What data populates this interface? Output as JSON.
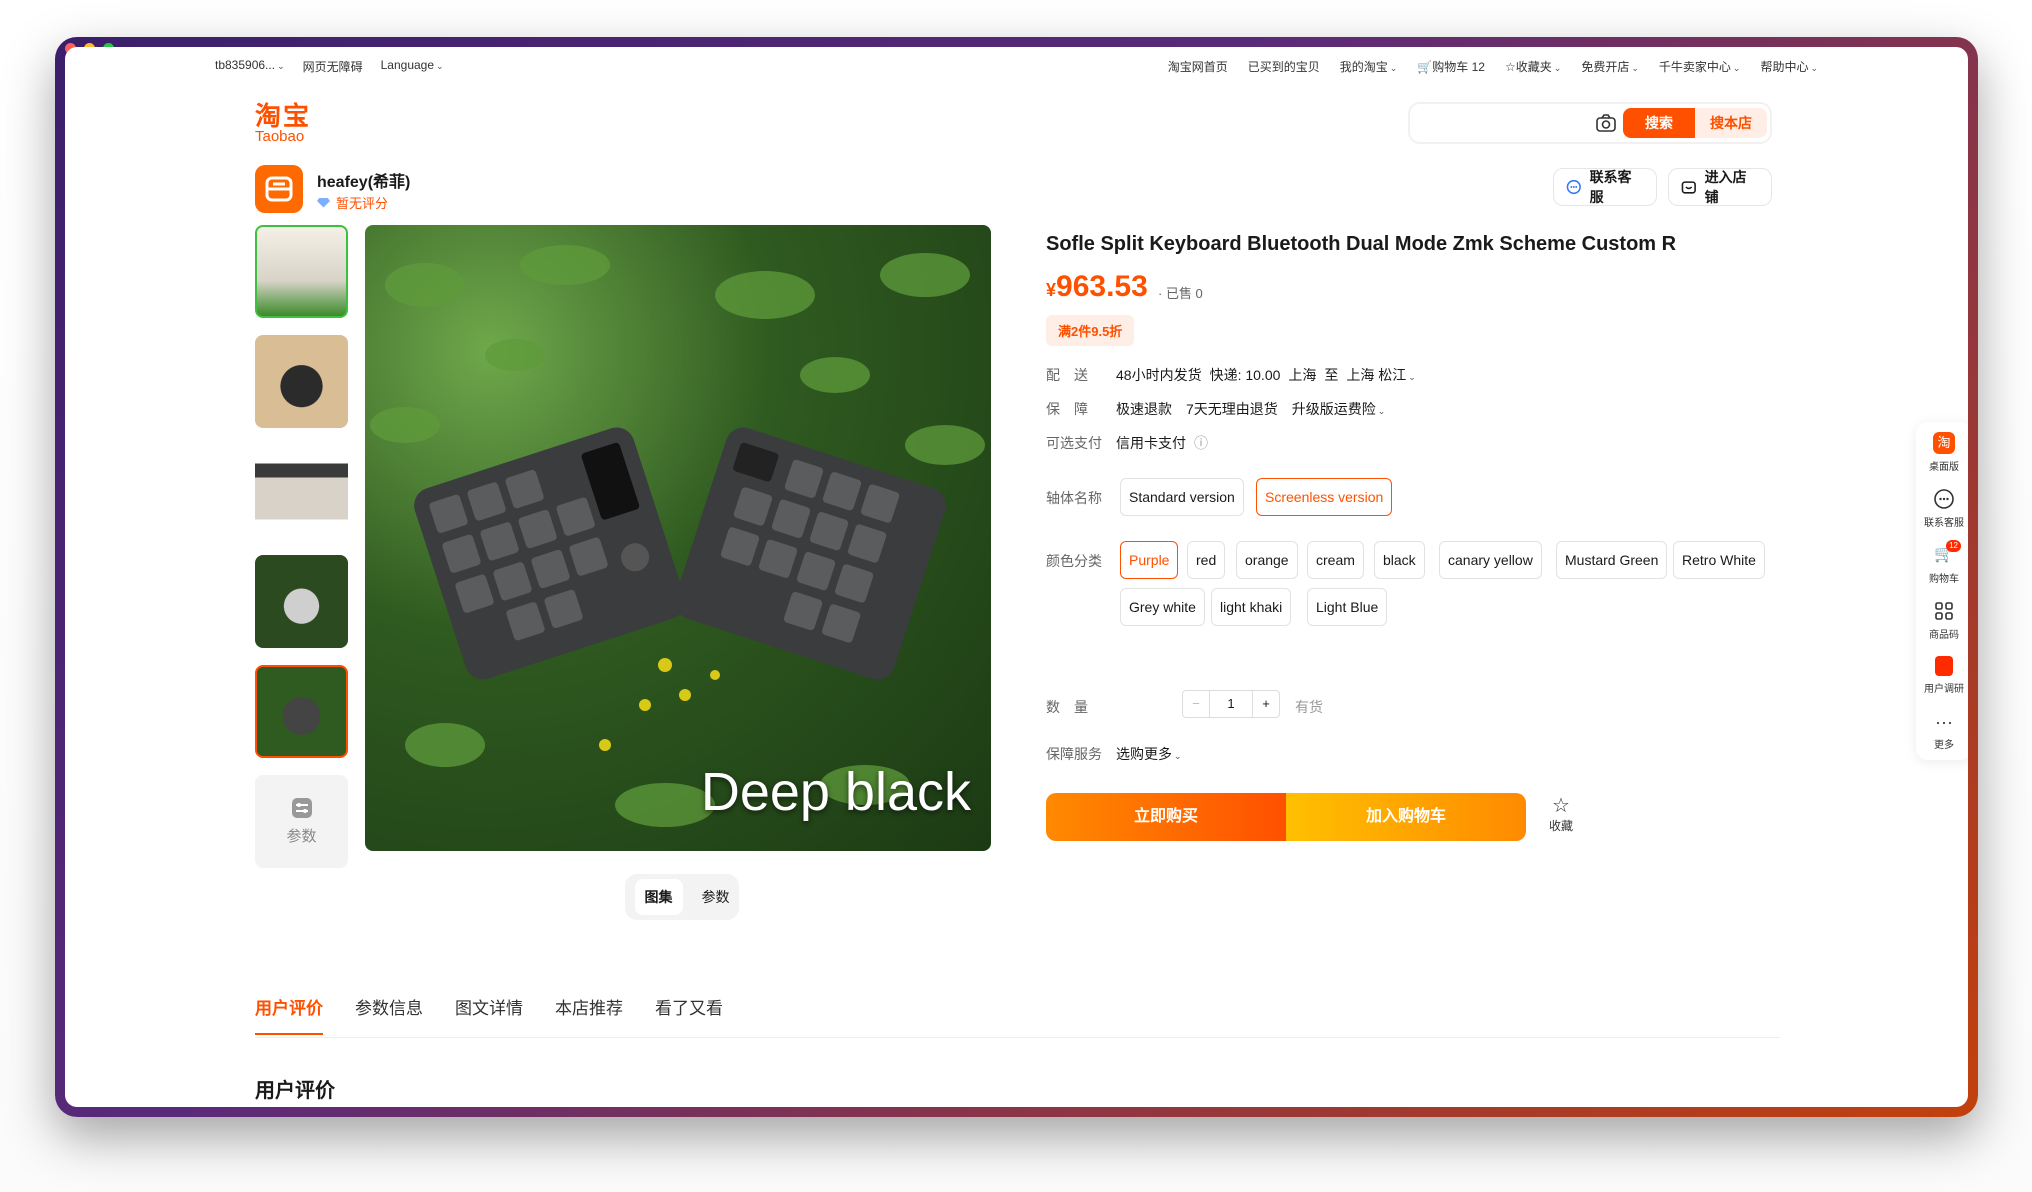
{
  "topbar": {
    "left": [
      "tb835906...",
      "网页无障碍",
      "Language"
    ],
    "right": [
      "淘宝网首页",
      "已买到的宝贝",
      "我的淘宝",
      "购物车 12",
      "收藏夹",
      "免费开店",
      "千牛卖家中心",
      "帮助中心"
    ]
  },
  "logo": {
    "cn": "淘宝",
    "en": "Taobao"
  },
  "search": {
    "placeholder": "",
    "search_label": "搜索",
    "store_label": "搜本店"
  },
  "shop": {
    "name": "heafey(希菲)",
    "rating": "暂无评分",
    "service_label": "联系客服",
    "enter_label": "进入店铺"
  },
  "gallery": {
    "main_label": "Deep black",
    "params_label": "参数",
    "tabs": [
      "图集",
      "参数"
    ]
  },
  "product": {
    "title": "Sofle Split Keyboard Bluetooth Dual Mode Zmk Scheme Custom R",
    "price_symbol": "¥",
    "price": "963.53",
    "sold": "· 已售 0",
    "promo": "满2件9.5折",
    "delivery_label": "配　送",
    "delivery": [
      "48小时内发货",
      "快递: 10.00",
      "上海",
      "至",
      "上海 松江"
    ],
    "guarantee_label": "保　障",
    "guarantee": [
      "极速退款",
      "7天无理由退货",
      "升级版运费险"
    ],
    "payment_label": "可选支付",
    "payment": "信用卡支付",
    "axis_label": "轴体名称",
    "axis_options": [
      "Standard version",
      "Screenless version"
    ],
    "color_label": "颜色分类",
    "color_options": [
      "Purple",
      "red",
      "orange",
      "cream",
      "black",
      "canary yellow",
      "Mustard Green",
      "Retro White",
      "Grey white",
      "light khaki",
      "Light Blue"
    ],
    "qty_label": "数　量",
    "qty_minus": "−",
    "qty_value": "1",
    "qty_plus": "+",
    "stock": "有货",
    "service_label": "保障服务",
    "service_value": "选购更多",
    "buy_now": "立即购买",
    "add_cart": "加入购物车",
    "fav_label": "收藏"
  },
  "bottom_tabs": [
    "用户评价",
    "参数信息",
    "图文详情",
    "本店推荐",
    "看了又看"
  ],
  "section_title": "用户评价",
  "sidebar": [
    "桌面版",
    "联系客服",
    "购物车",
    "商品码",
    "用户调研",
    "更多"
  ],
  "sidebar_cart_badge": "12",
  "colors": {
    "accent": "#ff5000",
    "accent_light": "#ffeee6"
  }
}
